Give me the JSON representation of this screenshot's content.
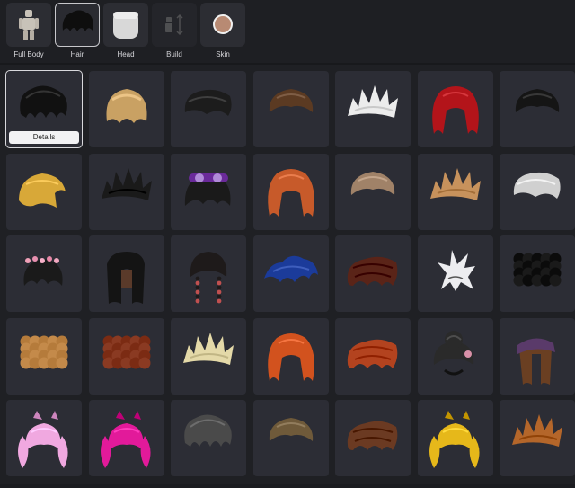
{
  "tabs": [
    {
      "label": "Full Body",
      "state": "normal"
    },
    {
      "label": "Hair",
      "state": "active"
    },
    {
      "label": "Head",
      "state": "normal"
    },
    {
      "label": "Build",
      "state": "disabled"
    },
    {
      "label": "Skin",
      "state": "normal"
    }
  ],
  "colors": {
    "background": "#1f2024",
    "tile": "#2c2d35",
    "skin_swatch": "#b88a73",
    "details_button": "#f2f2f4"
  },
  "details_label": "Details",
  "hair_items": [
    {
      "name": "black-messy-hair",
      "color": "#111111",
      "style": "messy"
    },
    {
      "name": "blonde-bob-hair",
      "color": "#c9a163",
      "style": "bob"
    },
    {
      "name": "dark-swept-hair",
      "color": "#1c1c1c",
      "style": "swept"
    },
    {
      "name": "brown-short-hair",
      "color": "#5b3a22",
      "style": "short"
    },
    {
      "name": "white-spiky-hair",
      "color": "#ececec",
      "style": "spiky"
    },
    {
      "name": "red-long-hair",
      "color": "#b3141a",
      "style": "long"
    },
    {
      "name": "black-emo-hair",
      "color": "#151515",
      "style": "short"
    },
    {
      "name": "blonde-side-hair",
      "color": "#d8a838",
      "style": "side"
    },
    {
      "name": "black-spiked-hair",
      "color": "#1a1a1a",
      "style": "spiky"
    },
    {
      "name": "black-hair-purple-goggles",
      "color": "#1a1a1a",
      "style": "goggles"
    },
    {
      "name": "orange-long-hair",
      "color": "#c75a2a",
      "style": "long"
    },
    {
      "name": "light-brown-hair",
      "color": "#a08268",
      "style": "short"
    },
    {
      "name": "blonde-spiky-hair",
      "color": "#c7925c",
      "style": "spiky"
    },
    {
      "name": "silver-swept-hair",
      "color": "#d0d0d0",
      "style": "swept"
    },
    {
      "name": "black-hair-pink-flowers",
      "color": "#1a1a1a",
      "style": "flowers"
    },
    {
      "name": "black-long-straight-hair",
      "color": "#141414",
      "style": "longstraight"
    },
    {
      "name": "black-braids-red-beads",
      "color": "#1e1a1a",
      "style": "braids"
    },
    {
      "name": "blue-wavy-hair",
      "color": "#1b3b9a",
      "style": "wavy"
    },
    {
      "name": "brown-red-layered-hair",
      "color": "#5a2418",
      "style": "layered"
    },
    {
      "name": "white-spiked-hair",
      "color": "#ededf0",
      "style": "crown"
    },
    {
      "name": "black-curly-hair",
      "color": "#1a1a1a",
      "style": "curly"
    },
    {
      "name": "blonde-curly-hair",
      "color": "#c48a4a",
      "style": "curly"
    },
    {
      "name": "auburn-curly-hair",
      "color": "#8a3a22",
      "style": "curly"
    },
    {
      "name": "platinum-spiky-hair",
      "color": "#e4d9a8",
      "style": "spiky"
    },
    {
      "name": "orange-flowing-hair",
      "color": "#d2521e",
      "style": "long"
    },
    {
      "name": "ginger-layered-hair",
      "color": "#b3431f",
      "style": "layered"
    },
    {
      "name": "black-bun-hair-flower",
      "color": "#2a2a2a",
      "style": "bun"
    },
    {
      "name": "brown-hair-purple-bandana",
      "color": "#6a3f22",
      "style": "bandana"
    },
    {
      "name": "pink-pigtails-hair",
      "color": "#f0a8e0",
      "style": "pigtails"
    },
    {
      "name": "magenta-buns-hair",
      "color": "#e21a9a",
      "style": "pigtails"
    },
    {
      "name": "gray-messy-hair",
      "color": "#4a4a4a",
      "style": "messy"
    },
    {
      "name": "olive-brown-hair",
      "color": "#6f5a3a",
      "style": "short"
    },
    {
      "name": "brown-fluffy-hair",
      "color": "#6b3a22",
      "style": "layered"
    },
    {
      "name": "yellow-bow-hair",
      "color": "#e6b81a",
      "style": "pigtails"
    },
    {
      "name": "copper-spiky-hair",
      "color": "#b4662a",
      "style": "spiky"
    }
  ]
}
